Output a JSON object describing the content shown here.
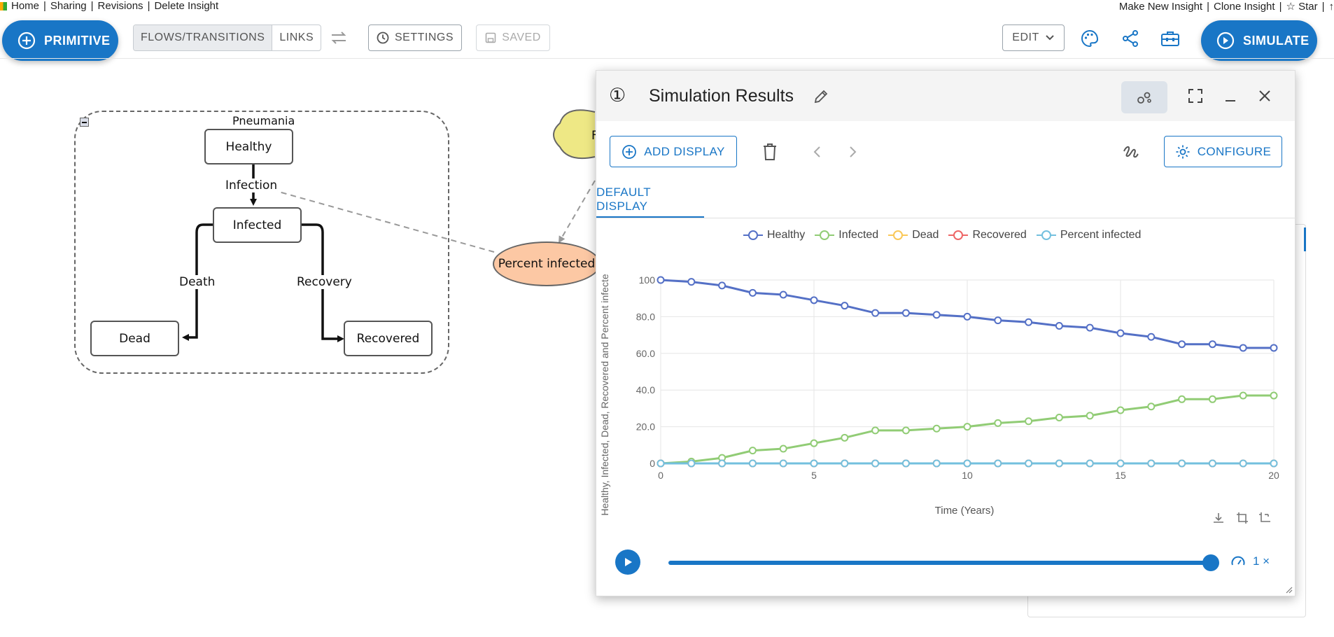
{
  "topbar": {
    "left_links": [
      "Home",
      "Sharing",
      "Revisions",
      "Delete Insight"
    ],
    "right_links": [
      "Make New Insight",
      "Clone Insight"
    ],
    "star_label": "☆ Star",
    "right_tail": "↑"
  },
  "toolbar": {
    "primitive_label": "PRIMITIVE",
    "flows_label": "FLOWS/TRANSITIONS",
    "links_label": "LINKS",
    "settings_label": "SETTINGS",
    "saved_label": "SAVED",
    "edit_label": "EDIT",
    "simulate_label": "SIMULATE"
  },
  "diagram": {
    "folder_label": "Pneumania",
    "nodes": {
      "healthy": "Healthy",
      "infected": "Infected",
      "dead": "Dead",
      "recovered": "Recovered",
      "percent_infected": "Percent infected",
      "cloud_partial": "F"
    },
    "flows": {
      "infection": "Infection",
      "death": "Death",
      "recovery": "Recovery"
    }
  },
  "results": {
    "number": "①",
    "title": "Simulation Results",
    "add_display_label": "ADD DISPLAY",
    "configure_label": "CONFIGURE",
    "tab_label": "DEFAULT DISPLAY",
    "speed_label": "1 ×",
    "slider_progress": 1.0
  },
  "colors": {
    "accent": "#1976c6",
    "healthy": "#5470c6",
    "infected": "#91cc75",
    "dead": "#fac858",
    "recovered": "#ee6666",
    "percent_infected": "#73c0de"
  },
  "chart_data": {
    "type": "line",
    "title": "",
    "xlabel": "Time (Years)",
    "ylabel": "Healthy, Infected, Dead, Recovered and Percent infecte",
    "xlim": [
      0,
      20
    ],
    "ylim": [
      0,
      100
    ],
    "x_ticks": [
      "0",
      "5",
      "10",
      "15",
      "20"
    ],
    "y_ticks": [
      "0",
      "20.0",
      "40.0",
      "60.0",
      "80.0",
      "100"
    ],
    "legend_position": "top",
    "x": [
      0,
      1,
      2,
      3,
      4,
      5,
      6,
      7,
      8,
      9,
      10,
      11,
      12,
      13,
      14,
      15,
      16,
      17,
      18,
      19,
      20
    ],
    "series": [
      {
        "name": "Healthy",
        "values": [
          100,
          99,
          97,
          93,
          92,
          89,
          86,
          82,
          82,
          81,
          80,
          78,
          77,
          75,
          74,
          71,
          69,
          65,
          65,
          63,
          63
        ]
      },
      {
        "name": "Infected",
        "values": [
          0,
          1,
          3,
          7,
          8,
          11,
          14,
          18,
          18,
          19,
          20,
          22,
          23,
          25,
          26,
          29,
          31,
          35,
          35,
          37,
          37
        ]
      },
      {
        "name": "Dead",
        "values": [
          0,
          0,
          0,
          0,
          0,
          0,
          0,
          0,
          0,
          0,
          0,
          0,
          0,
          0,
          0,
          0,
          0,
          0,
          0,
          0,
          0
        ]
      },
      {
        "name": "Recovered",
        "values": [
          0,
          0,
          0,
          0,
          0,
          0,
          0,
          0,
          0,
          0,
          0,
          0,
          0,
          0,
          0,
          0,
          0,
          0,
          0,
          0,
          0
        ]
      },
      {
        "name": "Percent infected",
        "values": [
          0,
          0,
          0,
          0,
          0,
          0,
          0,
          0,
          0,
          0,
          0,
          0,
          0,
          0,
          0,
          0,
          0,
          0,
          0,
          0,
          0
        ]
      }
    ]
  }
}
